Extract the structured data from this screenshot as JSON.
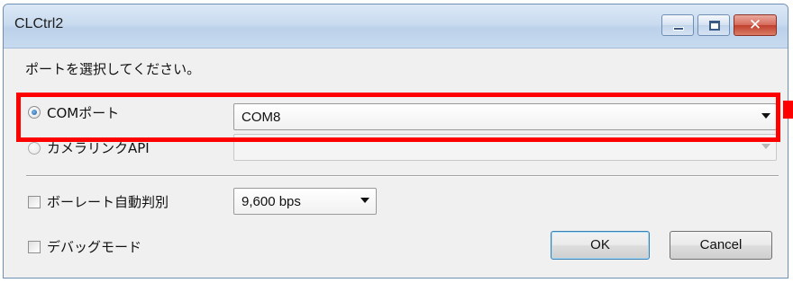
{
  "window": {
    "title": "CLCtrl2",
    "controls": {
      "minimize_icon": "minimize-icon",
      "maximize_icon": "maximize-icon",
      "close_icon": "close-icon",
      "close_glyph": "✕"
    }
  },
  "prompt": "ポートを選択してください。",
  "port_selection": {
    "com_port": {
      "label": "COMポート",
      "selected": true,
      "value": "COM8"
    },
    "camera_link": {
      "label": "カメラリンクAPI",
      "selected": false,
      "value": ""
    }
  },
  "options": {
    "auto_baud": {
      "label": "ボーレート自動判別",
      "checked": false,
      "value": "9,600 bps"
    },
    "debug_mode": {
      "label": "デバッグモード",
      "checked": false
    }
  },
  "buttons": {
    "ok": "OK",
    "cancel": "Cancel"
  },
  "colors": {
    "highlight": "#ff0000",
    "titlebar": "#c9dbef",
    "close_button": "#c0402d"
  }
}
